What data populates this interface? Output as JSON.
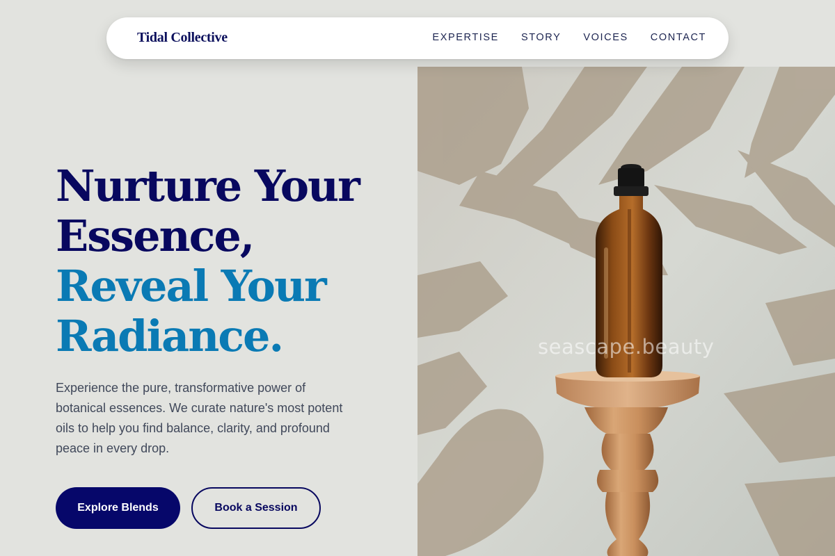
{
  "brand": {
    "name": "Tidal Collective"
  },
  "nav": {
    "items": [
      {
        "label": "EXPERTISE"
      },
      {
        "label": "STORY"
      },
      {
        "label": "VOICES"
      },
      {
        "label": "CONTACT"
      }
    ]
  },
  "hero": {
    "headline": {
      "line1": "Nurture Your",
      "line2": "Essence,",
      "line3": "Reveal Your",
      "line4": "Radiance."
    },
    "description": "Experience the pure, transformative power of botanical essences. We curate nature's most potent oils to help you find balance, clarity, and profound peace in every drop.",
    "primary_cta": "Explore Blends",
    "secondary_cta": "Book a Session",
    "image": {
      "subject": "amber dropper bottle on wooden pedestal with palm leaf shadows",
      "watermark": "seascape.beauty"
    }
  },
  "colors": {
    "navy": "#08085f",
    "accent_blue": "#0a7ab4",
    "background": "#e2e3df",
    "body_text": "#40485a"
  }
}
